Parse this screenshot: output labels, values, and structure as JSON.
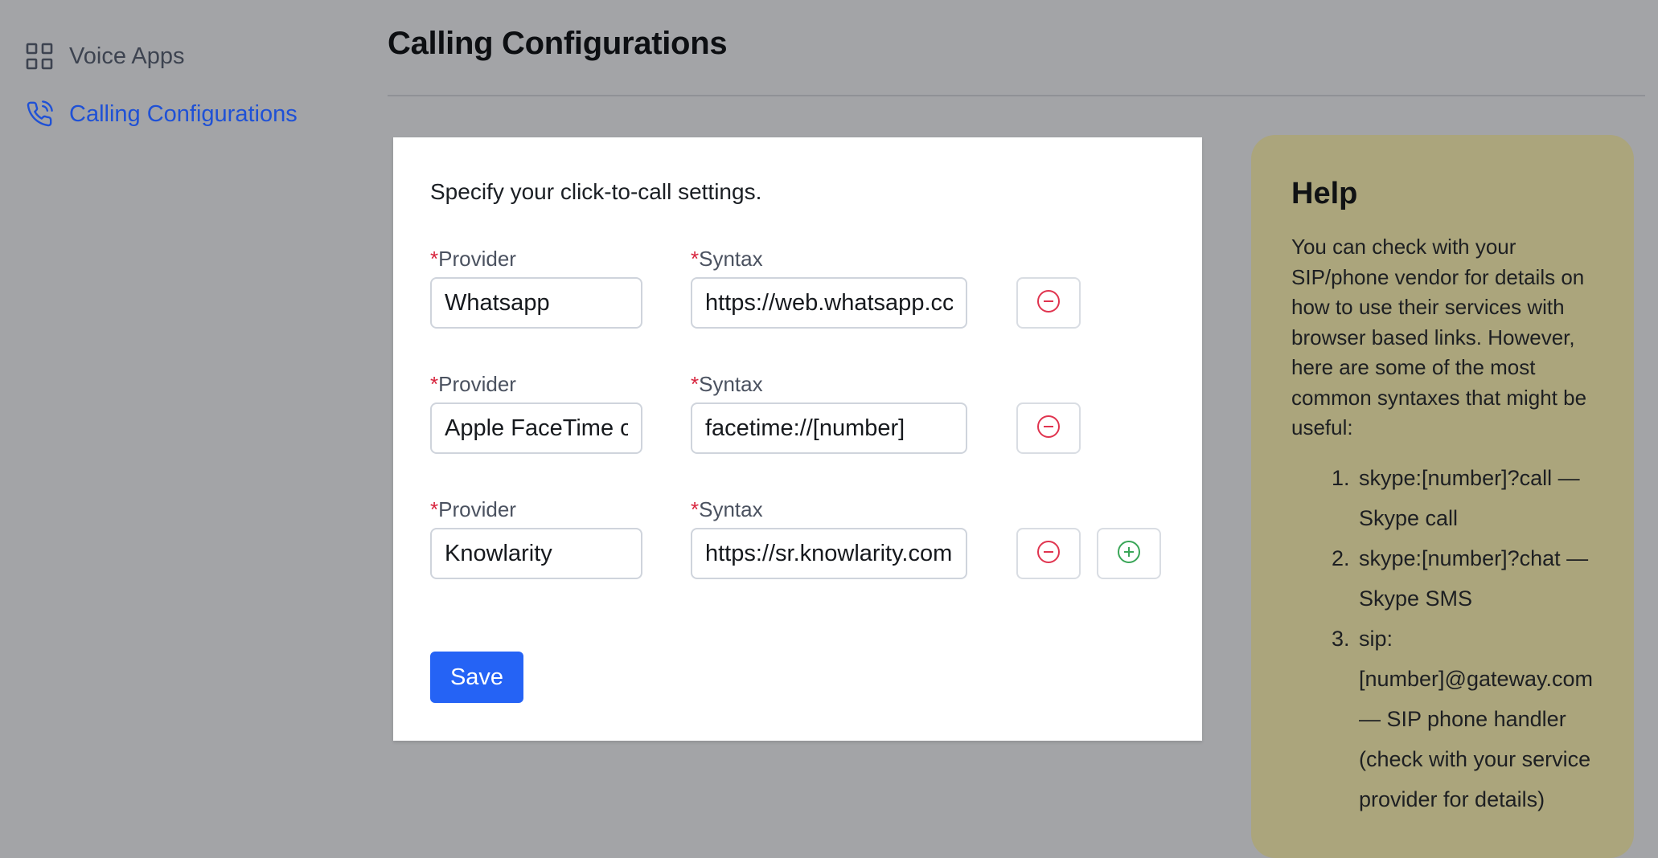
{
  "sidebar": {
    "items": [
      {
        "label": "Voice Apps",
        "icon": "grid-icon",
        "active": false
      },
      {
        "label": "Calling Configurations",
        "icon": "phone-call-icon",
        "active": true
      }
    ]
  },
  "page": {
    "title": "Calling Configurations"
  },
  "form": {
    "intro": "Specify your click-to-call settings.",
    "required_mark": "*",
    "provider_label": "Provider",
    "syntax_label": "Syntax",
    "rows": [
      {
        "provider": "Whatsapp",
        "syntax": "https://web.whatsapp.cc"
      },
      {
        "provider": "Apple FaceTime c",
        "syntax": "facetime://[number]"
      },
      {
        "provider": "Knowlarity",
        "syntax": "https://sr.knowlarity.com"
      }
    ],
    "save_label": "Save"
  },
  "help": {
    "title": "Help",
    "body": "You can check with your SIP/phone vendor for details on how to use their services with browser based links. However, here are some of the most common syntaxes that might be useful:",
    "items": [
      "skype:[number]?call — Skype call",
      "skype:[number]?chat — Skype SMS",
      "sip:[number]@gateway.com — SIP phone handler (check with your service provider for details)"
    ]
  },
  "colors": {
    "background": "#a3a4a7",
    "accent": "#1f51d6",
    "primary_button": "#2563f5",
    "required": "#d7243d",
    "remove_icon": "#e0344f",
    "add_icon": "#3aa658",
    "help_panel": "#aba57c"
  }
}
